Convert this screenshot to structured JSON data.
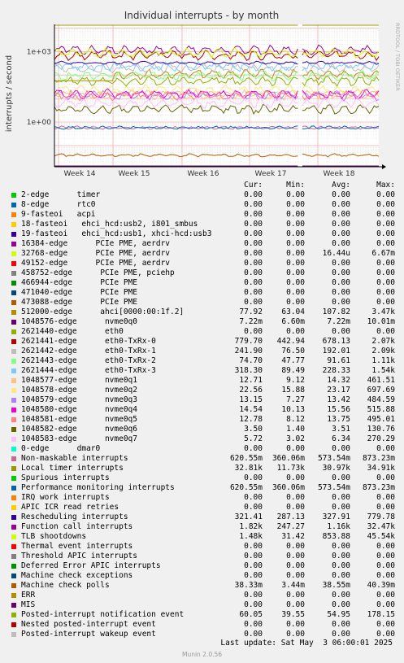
{
  "chart_data": {
    "type": "line",
    "title": "Individual interrupts - by month",
    "ylabel": "interrupts / second",
    "xlabel": "",
    "y_scale": "log",
    "yticks": [
      "1e-03",
      "1e+00",
      "1e+03"
    ],
    "xticks": [
      "Week 14",
      "Week 15",
      "Week 16",
      "Week 17",
      "Week 18"
    ],
    "watermark": "RRDTOOL / TOBI OETIKER",
    "columns": [
      "Cur:",
      "Min:",
      "Avg:",
      "Max:"
    ],
    "series": [
      {
        "name": "2-edge      timer",
        "color": "#00cc00",
        "cur": "0.00",
        "min": "0.00",
        "avg": "0.00",
        "max": "0.00"
      },
      {
        "name": "8-edge      rtc0",
        "color": "#0066b3",
        "cur": "0.00",
        "min": "0.00",
        "avg": "0.00",
        "max": "0.00"
      },
      {
        "name": "9-fasteoi   acpi",
        "color": "#ff8000",
        "cur": "0.00",
        "min": "0.00",
        "avg": "0.00",
        "max": "0.00"
      },
      {
        "name": "18-fasteoi   ehci_hcd:usb2, i801_smbus",
        "color": "#ffcc00",
        "cur": "0.00",
        "min": "0.00",
        "avg": "0.00",
        "max": "0.00"
      },
      {
        "name": "19-fasteoi   ehci_hcd:usb1, xhci-hcd:usb3",
        "color": "#330099",
        "cur": "0.00",
        "min": "0.00",
        "avg": "0.00",
        "max": "0.00"
      },
      {
        "name": "16384-edge      PCIe PME, aerdrv",
        "color": "#990099",
        "cur": "0.00",
        "min": "0.00",
        "avg": "0.00",
        "max": "0.00"
      },
      {
        "name": "32768-edge      PCIe PME, aerdrv",
        "color": "#ccff00",
        "cur": "0.00",
        "min": "0.00",
        "avg": "16.44u",
        "max": "6.67m"
      },
      {
        "name": "49152-edge      PCIe PME, aerdrv",
        "color": "#ff0000",
        "cur": "0.00",
        "min": "0.00",
        "avg": "0.00",
        "max": "0.00"
      },
      {
        "name": "458752-edge      PCIe PME, pciehp",
        "color": "#808080",
        "cur": "0.00",
        "min": "0.00",
        "avg": "0.00",
        "max": "0.00"
      },
      {
        "name": "466944-edge      PCIe PME",
        "color": "#008f00",
        "cur": "0.00",
        "min": "0.00",
        "avg": "0.00",
        "max": "0.00"
      },
      {
        "name": "471040-edge      PCIe PME",
        "color": "#00487d",
        "cur": "0.00",
        "min": "0.00",
        "avg": "0.00",
        "max": "0.00"
      },
      {
        "name": "473088-edge      PCIe PME",
        "color": "#b35a00",
        "cur": "0.00",
        "min": "0.00",
        "avg": "0.00",
        "max": "0.00"
      },
      {
        "name": "512000-edge      ahci[0000:00:1f.2]",
        "color": "#b38f00",
        "cur": "77.92",
        "min": "63.04",
        "avg": "107.82",
        "max": "3.47k"
      },
      {
        "name": "1048576-edge      nvme0q0",
        "color": "#6b006b",
        "cur": "7.22m",
        "min": "6.60m",
        "avg": "7.22m",
        "max": "10.01m"
      },
      {
        "name": "2621440-edge      eth0",
        "color": "#8fb300",
        "cur": "0.00",
        "min": "0.00",
        "avg": "0.00",
        "max": "0.00"
      },
      {
        "name": "2621441-edge      eth0-TxRx-0",
        "color": "#b30000",
        "cur": "779.70",
        "min": "442.94",
        "avg": "678.13",
        "max": "2.07k"
      },
      {
        "name": "2621442-edge      eth0-TxRx-1",
        "color": "#bebebe",
        "cur": "241.90",
        "min": "76.50",
        "avg": "192.01",
        "max": "2.09k"
      },
      {
        "name": "2621443-edge      eth0-TxRx-2",
        "color": "#80ff80",
        "cur": "74.70",
        "min": "47.77",
        "avg": "91.61",
        "max": "1.11k"
      },
      {
        "name": "2621444-edge      eth0-TxRx-3",
        "color": "#80c9ff",
        "cur": "318.30",
        "min": "89.49",
        "avg": "228.33",
        "max": "1.54k"
      },
      {
        "name": "1048577-edge      nvme0q1",
        "color": "#ffc080",
        "cur": "12.71",
        "min": "9.12",
        "avg": "14.32",
        "max": "461.51"
      },
      {
        "name": "1048578-edge      nvme0q2",
        "color": "#ffe680",
        "cur": "22.56",
        "min": "15.88",
        "avg": "23.17",
        "max": "697.69"
      },
      {
        "name": "1048579-edge      nvme0q3",
        "color": "#aa80ff",
        "cur": "13.15",
        "min": "7.27",
        "avg": "13.42",
        "max": "484.59"
      },
      {
        "name": "1048580-edge      nvme0q4",
        "color": "#ee00cc",
        "cur": "14.54",
        "min": "10.13",
        "avg": "15.56",
        "max": "515.88"
      },
      {
        "name": "1048581-edge      nvme0q5",
        "color": "#ff8080",
        "cur": "12.78",
        "min": "8.12",
        "avg": "13.75",
        "max": "495.01"
      },
      {
        "name": "1048582-edge      nvme0q6",
        "color": "#666600",
        "cur": "3.50",
        "min": "1.40",
        "avg": "3.51",
        "max": "130.76"
      },
      {
        "name": "1048583-edge      nvme0q7",
        "color": "#ffbfff",
        "cur": "5.72",
        "min": "3.02",
        "avg": "6.34",
        "max": "270.29"
      },
      {
        "name": "0-edge      dmar0",
        "color": "#00ffcc",
        "cur": "0.00",
        "min": "0.00",
        "avg": "0.00",
        "max": "0.00"
      },
      {
        "name": "Non-maskable interrupts",
        "color": "#cc6699",
        "cur": "620.55m",
        "min": "360.06m",
        "avg": "573.54m",
        "max": "873.23m"
      },
      {
        "name": "Local timer interrupts",
        "color": "#999900",
        "cur": "32.81k",
        "min": "11.73k",
        "avg": "30.97k",
        "max": "34.91k"
      },
      {
        "name": "Spurious interrupts",
        "color": "#00cc00",
        "cur": "0.00",
        "min": "0.00",
        "avg": "0.00",
        "max": "0.00"
      },
      {
        "name": "Performance monitoring interrupts",
        "color": "#0066b3",
        "cur": "620.55m",
        "min": "360.06m",
        "avg": "573.54m",
        "max": "873.23m"
      },
      {
        "name": "IRQ work interrupts",
        "color": "#ff8000",
        "cur": "0.00",
        "min": "0.00",
        "avg": "0.00",
        "max": "0.00"
      },
      {
        "name": "APIC ICR read retries",
        "color": "#ffcc00",
        "cur": "0.00",
        "min": "0.00",
        "avg": "0.00",
        "max": "0.00"
      },
      {
        "name": "Rescheduling interrupts",
        "color": "#330099",
        "cur": "321.41",
        "min": "287.13",
        "avg": "327.91",
        "max": "779.78"
      },
      {
        "name": "Function call interrupts",
        "color": "#990099",
        "cur": "1.82k",
        "min": "247.27",
        "avg": "1.16k",
        "max": "32.47k"
      },
      {
        "name": "TLB shootdowns",
        "color": "#ccff00",
        "cur": "1.48k",
        "min": "31.42",
        "avg": "853.88",
        "max": "45.54k"
      },
      {
        "name": "Thermal event interrupts",
        "color": "#ff0000",
        "cur": "0.00",
        "min": "0.00",
        "avg": "0.00",
        "max": "0.00"
      },
      {
        "name": "Threshold APIC interrupts",
        "color": "#808080",
        "cur": "0.00",
        "min": "0.00",
        "avg": "0.00",
        "max": "0.00"
      },
      {
        "name": "Deferred Error APIC interrupts",
        "color": "#008f00",
        "cur": "0.00",
        "min": "0.00",
        "avg": "0.00",
        "max": "0.00"
      },
      {
        "name": "Machine check exceptions",
        "color": "#00487d",
        "cur": "0.00",
        "min": "0.00",
        "avg": "0.00",
        "max": "0.00"
      },
      {
        "name": "Machine check polls",
        "color": "#b35a00",
        "cur": "38.33m",
        "min": "3.44m",
        "avg": "38.55m",
        "max": "40.39m"
      },
      {
        "name": "ERR",
        "color": "#b38f00",
        "cur": "0.00",
        "min": "0.00",
        "avg": "0.00",
        "max": "0.00"
      },
      {
        "name": "MIS",
        "color": "#6b006b",
        "cur": "0.00",
        "min": "0.00",
        "avg": "0.00",
        "max": "0.00"
      },
      {
        "name": "Posted-interrupt notification event",
        "color": "#8fb300",
        "cur": "60.05",
        "min": "39.55",
        "avg": "54.95",
        "max": "178.15"
      },
      {
        "name": "Nested posted-interrupt event",
        "color": "#b30000",
        "cur": "0.00",
        "min": "0.00",
        "avg": "0.00",
        "max": "0.00"
      },
      {
        "name": "Posted-interrupt wakeup event",
        "color": "#bebebe",
        "cur": "0.00",
        "min": "0.00",
        "avg": "0.00",
        "max": "0.00"
      }
    ]
  },
  "footer": {
    "last_update": "Last update: Sat May  3 06:00:01 2025",
    "munin": "Munin 2.0.56"
  }
}
